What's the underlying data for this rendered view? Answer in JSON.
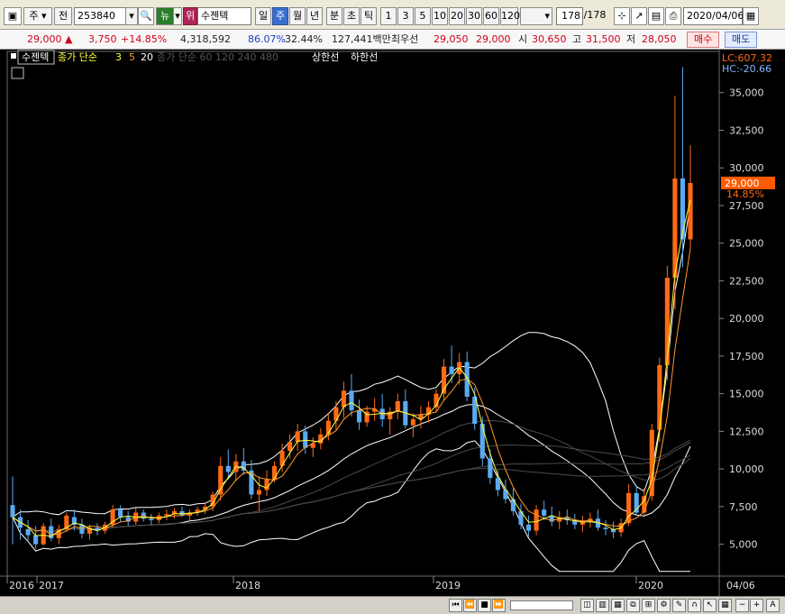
{
  "toolbar": {
    "type_select": "주",
    "prefix_label": "전",
    "code_value": "253840",
    "market_badge": "뉴",
    "alert_badge": "위",
    "stock_name": "수젠텍",
    "period_buttons": [
      "일",
      "주",
      "월",
      "년"
    ],
    "active_period": "주",
    "time_buttons": [
      "분",
      "초",
      "틱"
    ],
    "interval_buttons": [
      "1",
      "3",
      "5",
      "10",
      "20",
      "30",
      "60",
      "120"
    ],
    "count_value": "178",
    "count_total": "/178",
    "date_value": "2020/04/06"
  },
  "quote": {
    "price": "29,000",
    "arrow": "▲",
    "change": "3,750",
    "change_pct": "+14.85%",
    "volume": "4,318,592",
    "ratio1": "86.07%",
    "ratio2": "32.44%",
    "amount": "127,441백만",
    "best_label": "최우선",
    "best_ask": "29,050",
    "best_bid": "29,000",
    "open_label": "시",
    "open": "30,650",
    "high_label": "고",
    "high": "31,500",
    "low_label": "저",
    "low": "28,050",
    "buy_label": "매수",
    "sell_label": "매도"
  },
  "legend": {
    "stock_tag": "수젠텍",
    "ma_label": "종가 단순",
    "ma_periods": [
      "3",
      "5",
      "20"
    ],
    "long_ma_label": "종가 단순 60 120 240 480",
    "upper_limit": "상한선",
    "lower_limit": "하한선"
  },
  "right_top": {
    "lc": "LC:607.32",
    "hc": "HC:-20.66"
  },
  "price_tag": {
    "value": "29,000",
    "pct": "14.85%"
  },
  "colors": {
    "up": "#ff6a13",
    "down": "#5aaaf0",
    "ma3": "#ffff40",
    "ma5": "#ff9930",
    "band": "#ffffff",
    "long_ma": "#555555",
    "price_tag": "#ff5a00",
    "accent_blue": "#3a6fd0"
  },
  "chart_data": {
    "type": "candlestick",
    "y_axis_ticks": [
      "35,000",
      "32,500",
      "30,000",
      "27,500",
      "25,000",
      "22,500",
      "20,000",
      "17,500",
      "15,000",
      "12,500",
      "10,000",
      "7,500",
      "5,000"
    ],
    "ylim": [
      3000,
      37500
    ],
    "x_axis_labels": [
      "2016",
      "2017",
      "2018",
      "2019",
      "2020",
      "04/06"
    ],
    "last_close": 29000,
    "candles": [
      [
        7600,
        9500,
        5000,
        6800
      ],
      [
        6800,
        7300,
        5300,
        6100
      ],
      [
        6000,
        6600,
        5200,
        5600
      ],
      [
        5600,
        6200,
        4700,
        5000
      ],
      [
        5000,
        6400,
        4900,
        6200
      ],
      [
        6200,
        6700,
        5200,
        5400
      ],
      [
        5400,
        6300,
        5000,
        6000
      ],
      [
        6000,
        7100,
        5800,
        6900
      ],
      [
        6800,
        7300,
        5900,
        6300
      ],
      [
        6300,
        6700,
        5400,
        5700
      ],
      [
        5700,
        6300,
        5300,
        6100
      ],
      [
        6100,
        6400,
        5600,
        5900
      ],
      [
        5900,
        6500,
        5700,
        6300
      ],
      [
        6300,
        7600,
        6100,
        7300
      ],
      [
        7300,
        7600,
        6500,
        6800
      ],
      [
        6800,
        7200,
        6200,
        6500
      ],
      [
        6500,
        7400,
        6300,
        7100
      ],
      [
        7100,
        7300,
        6500,
        6700
      ],
      [
        6700,
        7000,
        6300,
        6600
      ],
      [
        6600,
        7100,
        6400,
        6900
      ],
      [
        6900,
        7300,
        6600,
        7000
      ],
      [
        7000,
        7400,
        6700,
        7200
      ],
      [
        7200,
        7500,
        6800,
        6900
      ],
      [
        6900,
        7300,
        6600,
        7100
      ],
      [
        7100,
        7500,
        6900,
        7300
      ],
      [
        7300,
        7800,
        7000,
        7500
      ],
      [
        7500,
        8500,
        7200,
        8300
      ],
      [
        8300,
        10800,
        7900,
        10200
      ],
      [
        10200,
        11300,
        9400,
        9800
      ],
      [
        9800,
        11000,
        9200,
        10500
      ],
      [
        10500,
        11400,
        9600,
        9900
      ],
      [
        9900,
        10600,
        8000,
        8300
      ],
      [
        8300,
        9500,
        7200,
        8600
      ],
      [
        8600,
        9900,
        8200,
        9300
      ],
      [
        9300,
        10500,
        9100,
        10200
      ],
      [
        10200,
        11700,
        9800,
        11200
      ],
      [
        11200,
        12300,
        10700,
        11800
      ],
      [
        11800,
        13000,
        11200,
        12500
      ],
      [
        12500,
        12900,
        11000,
        11400
      ],
      [
        11400,
        12100,
        10800,
        11700
      ],
      [
        11700,
        12700,
        11300,
        12300
      ],
      [
        12300,
        13600,
        11900,
        13200
      ],
      [
        13200,
        14500,
        12600,
        14100
      ],
      [
        14100,
        15800,
        13400,
        15200
      ],
      [
        15200,
        16300,
        13500,
        13900
      ],
      [
        13900,
        14600,
        12600,
        13100
      ],
      [
        13100,
        14200,
        12800,
        13800
      ],
      [
        13800,
        14700,
        13200,
        14000
      ],
      [
        14000,
        15000,
        12800,
        13300
      ],
      [
        13300,
        14100,
        12300,
        13800
      ],
      [
        13800,
        15000,
        13300,
        14500
      ],
      [
        14500,
        15300,
        12700,
        12900
      ],
      [
        12900,
        13700,
        12100,
        13300
      ],
      [
        13300,
        14200,
        12700,
        13600
      ],
      [
        13600,
        14500,
        13100,
        14100
      ],
      [
        14100,
        15300,
        13800,
        15000
      ],
      [
        15000,
        17300,
        14600,
        16800
      ],
      [
        16800,
        18200,
        15700,
        16300
      ],
      [
        16300,
        17700,
        15600,
        17100
      ],
      [
        17100,
        17800,
        14500,
        14800
      ],
      [
        14800,
        15400,
        12600,
        13000
      ],
      [
        13000,
        13500,
        10200,
        10700
      ],
      [
        10700,
        11300,
        9000,
        9400
      ],
      [
        9400,
        9900,
        8200,
        8600
      ],
      [
        8600,
        9300,
        7700,
        8000
      ],
      [
        8000,
        8700,
        6900,
        7200
      ],
      [
        7200,
        7700,
        6000,
        6300
      ],
      [
        6300,
        6900,
        5500,
        5900
      ],
      [
        5900,
        7600,
        5600,
        7300
      ],
      [
        7300,
        7900,
        6600,
        6900
      ],
      [
        6900,
        7500,
        6200,
        6500
      ],
      [
        6500,
        7200,
        6000,
        6800
      ],
      [
        6800,
        7300,
        6300,
        6600
      ],
      [
        6600,
        7000,
        6000,
        6300
      ],
      [
        6300,
        6900,
        5800,
        6500
      ],
      [
        6500,
        7100,
        6100,
        6700
      ],
      [
        6700,
        7300,
        5900,
        6100
      ],
      [
        6100,
        6600,
        5600,
        6000
      ],
      [
        6000,
        6500,
        5400,
        5800
      ],
      [
        5800,
        6700,
        5500,
        6400
      ],
      [
        6400,
        9000,
        6200,
        8400
      ],
      [
        8400,
        8900,
        6900,
        7100
      ],
      [
        7100,
        8700,
        6900,
        8200
      ],
      [
        8200,
        13000,
        7900,
        12600
      ],
      [
        12600,
        17400,
        11800,
        16900
      ],
      [
        16900,
        23500,
        15900,
        22700
      ],
      [
        22700,
        34800,
        20600,
        29300
      ],
      [
        29300,
        36700,
        23400,
        25250
      ],
      [
        25250,
        31500,
        24600,
        29000
      ]
    ],
    "bands": {
      "upper_peak_price": 19500,
      "lower_trough_price": 2500
    }
  },
  "bottombar": {
    "icons": [
      "⏮",
      "⏪",
      "■",
      "⏩"
    ]
  }
}
